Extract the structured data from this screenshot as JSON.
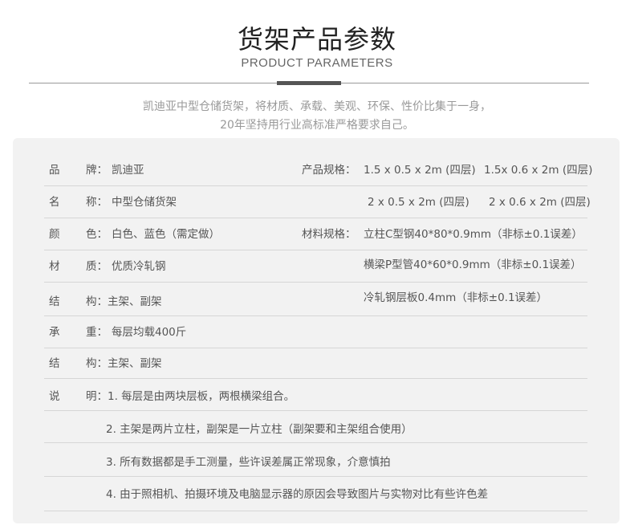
{
  "header": {
    "title_cn": "货架产品参数",
    "title_en": "PRODUCT PARAMETERS"
  },
  "intro": {
    "line1": "凯迪亚中型仓储货架，将材质、承载、美观、环保、性价比集于一身，",
    "line2": "20年坚持用行业高标准严格要求自己。"
  },
  "specs": {
    "brand": {
      "k1": "品",
      "k2": "牌：",
      "value": "凯迪亚"
    },
    "name": {
      "k1": "名",
      "k2": "称：",
      "value": "中型仓储货架"
    },
    "color": {
      "k1": "颜",
      "k2": "色：",
      "value": "白色、蓝色（需定做）"
    },
    "material": {
      "k1": "材",
      "k2": "质：",
      "value": "优质冷轧钢"
    },
    "structure1": {
      "k1": "结",
      "text": "构：主架、副架"
    },
    "load": {
      "k1": "承",
      "k2": "重：",
      "value": "每层均载400斤"
    },
    "structure2": {
      "k1": "结",
      "text": "构：主架、副架"
    },
    "note": {
      "k1": "说",
      "text": "明：1. 每层是由两块层板，两根横梁组合。"
    },
    "notes_extra": [
      "2. 主架是两片立柱，副架是一片立柱（副架要和主架组合使用）",
      "3. 所有数据都是手工测量，些许误差属正常现象，介意慎拍",
      "4. 由于照相机、拍摄环境及电脑显示器的原因会导致图片与实物对比有些许色差"
    ]
  },
  "product_specs": {
    "label": "产品规格：",
    "row1": [
      "1.5 x 0.5 x 2m (四层)",
      "1.5x 0.6 x 2m (四层)"
    ],
    "row2": [
      "2 x 0.5 x 2m (四层)",
      "2 x 0.6 x 2m (四层)"
    ]
  },
  "material_specs": {
    "label": "材料规格：",
    "items": [
      "立柱C型钢40*80*0.9mm（非标±0.1误差）",
      "横梁P型管40*60*0.9mm（非标±0.1误差）",
      "冷轧钢层板0.4mm（非标±0.1误差）"
    ]
  }
}
